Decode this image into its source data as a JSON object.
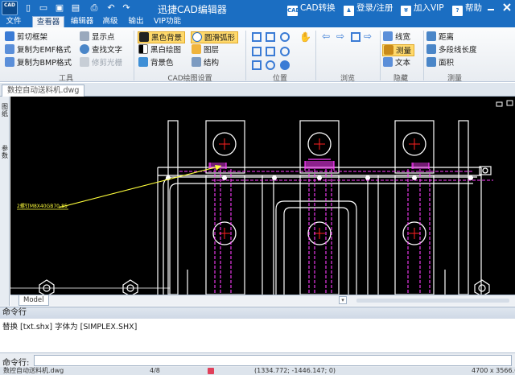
{
  "app": {
    "title": "迅捷CAD编辑器",
    "logo_text": "CAD"
  },
  "title_actions": {
    "convert_label": "CAD转换",
    "convert_icon_text": "CAD",
    "login_label": "登录/注册",
    "vip_label": "加入VIP",
    "help_label": "帮助"
  },
  "menu": {
    "tabs": [
      {
        "label": "文件"
      },
      {
        "label": "查看器"
      },
      {
        "label": "编辑器"
      },
      {
        "label": "高级"
      },
      {
        "label": "输出"
      },
      {
        "label": "VIP功能"
      }
    ],
    "active_tab": "查看器"
  },
  "ribbon": {
    "tools": {
      "label": "工具",
      "items": {
        "clip_frame": "剪切框架",
        "copy_emf": "复制为EMF格式",
        "copy_bmp": "复制为BMP格式",
        "show_points": "显示点",
        "find_text": "查找文字",
        "trim_raster": "修剪光栅"
      }
    },
    "cad_settings": {
      "label": "CAD绘图设置",
      "items": {
        "black_bg": "黑色背景",
        "smooth_arc": "圆滑弧形",
        "bw_drawing": "黑白绘图",
        "layers": "图层",
        "bg_color": "背景色",
        "structure": "结构"
      }
    },
    "position": {
      "label": "位置"
    },
    "browse": {
      "label": "浏览"
    },
    "hide": {
      "label": "隐藏",
      "items": {
        "line_width": "线宽",
        "measure": "测量",
        "text": "文本"
      }
    },
    "measure": {
      "label": "测量",
      "items": {
        "distance": "距离",
        "polyline_length": "多段线长度",
        "area": "面积"
      }
    }
  },
  "document": {
    "tab_label": "数控自动送料机.dwg"
  },
  "left_panel": {
    "items": [
      {
        "label": "图纸"
      },
      {
        "label": "参数"
      }
    ]
  },
  "drawing": {
    "annotation": "2螺钉M8X40GB70-85"
  },
  "model_tab": "Model",
  "command": {
    "header": "命令行",
    "output_line": "替换 [txt.shx] 字体为 [SIMPLEX.SHX]",
    "input_label": "命令行:",
    "input_value": ""
  },
  "status": {
    "file": "数控自动送料机.dwg",
    "page": "4/8",
    "coordinates": "(1334.772; -1446.147; 0)",
    "size": "4700 x 3566.6"
  },
  "colors": {
    "title_bar": "#1b6ec2",
    "canvas_bg": "#000000",
    "drawing_white": "#ffffff",
    "drawing_magenta": "#ff3cff",
    "drawing_yellow": "#ffff3c",
    "drawing_red": "#ff2020",
    "highlight": "#ffd96b"
  }
}
